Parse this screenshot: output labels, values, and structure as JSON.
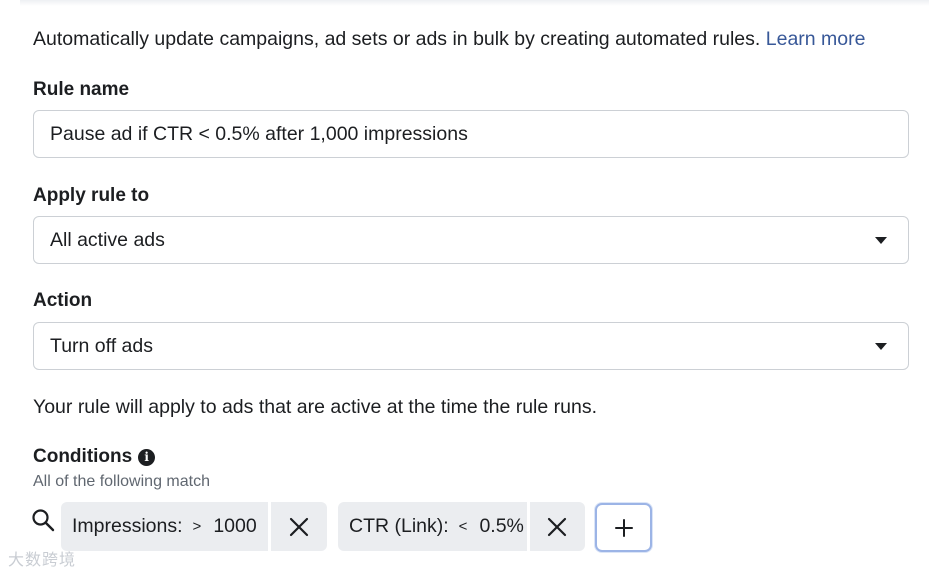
{
  "intro": {
    "text": "Automatically update campaigns, ad sets or ads in bulk by creating automated rules.",
    "link_label": "Learn more"
  },
  "rule_name": {
    "label": "Rule name",
    "value": "Pause ad if CTR < 0.5% after 1,000 impressions"
  },
  "apply_rule_to": {
    "label": "Apply rule to",
    "selected": "All active ads"
  },
  "action": {
    "label": "Action",
    "selected": "Turn off ads"
  },
  "note": "Your rule will apply to ads that are active at the time the rule runs.",
  "conditions": {
    "label": "Conditions",
    "match_text": "All of the following match",
    "items": [
      {
        "metric": "Impressions:",
        "operator": ">",
        "value": "1000"
      },
      {
        "metric": "CTR (Link):",
        "operator": "<",
        "value": "0.5%"
      }
    ]
  },
  "watermark": "大数跨境",
  "icons": {
    "info": "info-icon",
    "search": "search-icon",
    "remove": "close-icon",
    "add": "plus-icon",
    "dropdown": "caret-down-icon"
  },
  "colors": {
    "link": "#385898",
    "text": "#1c1e21",
    "chip_bg": "#ebedf0",
    "border": "#ccd0d5",
    "focus_ring": "#9cb4e6"
  }
}
